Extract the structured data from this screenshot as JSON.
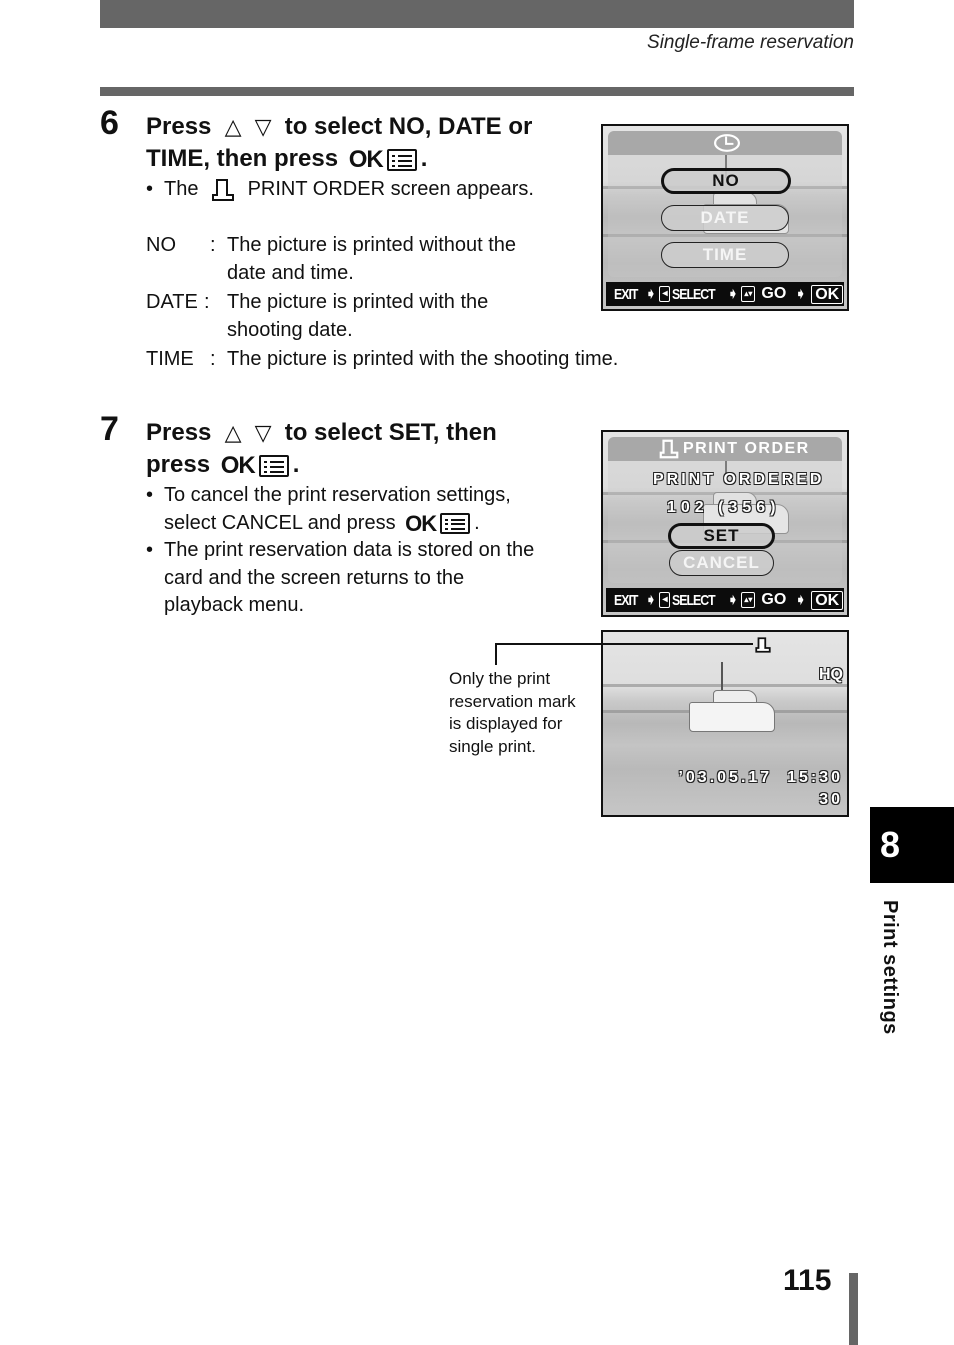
{
  "header": {
    "section_title": "Single-frame reservation"
  },
  "step6": {
    "number": "6",
    "heading_press": "Press",
    "up_symbol": "△",
    "down_symbol": "▽",
    "heading_rest_line1": "to select NO, DATE or",
    "heading_line2_prefix": "TIME, then press",
    "ok_label": "OK",
    "period": ".",
    "bullet_the": "The",
    "bullet_rest": "PRINT ORDER screen appears.",
    "definitions": [
      {
        "term": "NO",
        "colon": ":",
        "desc_line1": "The picture is printed without the",
        "desc_line2": "date and time."
      },
      {
        "term": "DATE",
        "colon": ":",
        "desc_line1": "The picture is printed with the",
        "desc_line2": "shooting date."
      },
      {
        "term": "TIME",
        "colon": ":",
        "desc_line1": "The picture is printed with the shooting time.",
        "desc_line2": ""
      }
    ],
    "screen": {
      "title_icon": "clock-icon",
      "options": [
        "NO",
        "DATE",
        "TIME"
      ],
      "selected": "NO"
    }
  },
  "step7": {
    "number": "7",
    "heading_press": "Press",
    "up_symbol": "△",
    "down_symbol": "▽",
    "heading_rest_line1": "to select SET, then",
    "heading_line2_prefix": "press",
    "ok_label": "OK",
    "period": ".",
    "bullets": [
      {
        "line1": "To cancel the print reservation settings,",
        "line2_prefix": "select CANCEL and press",
        "ok_label": "OK",
        "period": "."
      },
      {
        "line1": "The print reservation data is stored on the",
        "line2": "card and the screen returns to the",
        "line3": "playback menu."
      }
    ],
    "screen": {
      "title": "PRINT ORDER",
      "status": "PRINT ORDERED",
      "count": "102 (356)",
      "options": [
        "SET",
        "CANCEL"
      ],
      "selected": "SET"
    }
  },
  "lcd_footer": {
    "exit": "EXIT",
    "select": "SELECT",
    "go": "GO",
    "ok": "OK"
  },
  "playback_screen": {
    "quality": "HQ",
    "datetime": "’03.05.17  15:30",
    "frame": "30",
    "mark_icon": "print-reservation-icon"
  },
  "callout": {
    "text_line1": "Only the print",
    "text_line2": "reservation mark",
    "text_line3": "is displayed for",
    "text_line4": "single print."
  },
  "chapter": {
    "number": "8",
    "label": "Print settings"
  },
  "page_number": "115"
}
